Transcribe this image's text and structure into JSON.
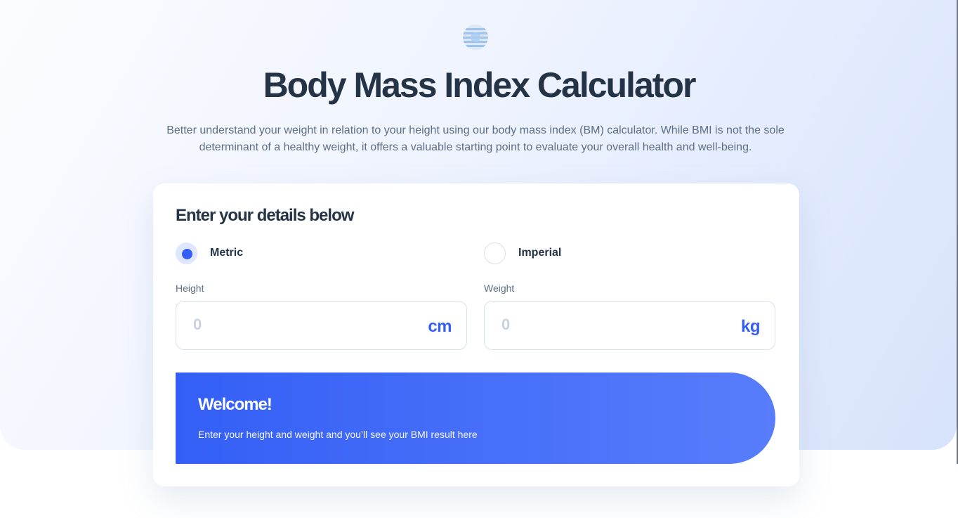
{
  "header": {
    "logo_icon": "bmi-logo-icon",
    "title": "Body Mass Index Calculator",
    "intro": "Better understand your weight in relation to your height using our body mass index (BM) calculator. While BMI is not the sole determinant of a healthy weight, it offers a valuable starting point to evaluate your overall health and well-being."
  },
  "form": {
    "title": "Enter your details below",
    "units": {
      "selected": "metric",
      "metric_label": "Metric",
      "imperial_label": "Imperial"
    },
    "height": {
      "label": "Height",
      "value": "",
      "placeholder": "0",
      "unit": "cm"
    },
    "weight": {
      "label": "Weight",
      "value": "",
      "placeholder": "0",
      "unit": "kg"
    }
  },
  "result": {
    "title": "Welcome!",
    "message": "Enter your height and weight and you’ll see your BMI result here"
  },
  "colors": {
    "accent": "#345FF6",
    "heading": "#253347",
    "muted_text": "#5E6E84",
    "border": "#D8E0EC"
  }
}
